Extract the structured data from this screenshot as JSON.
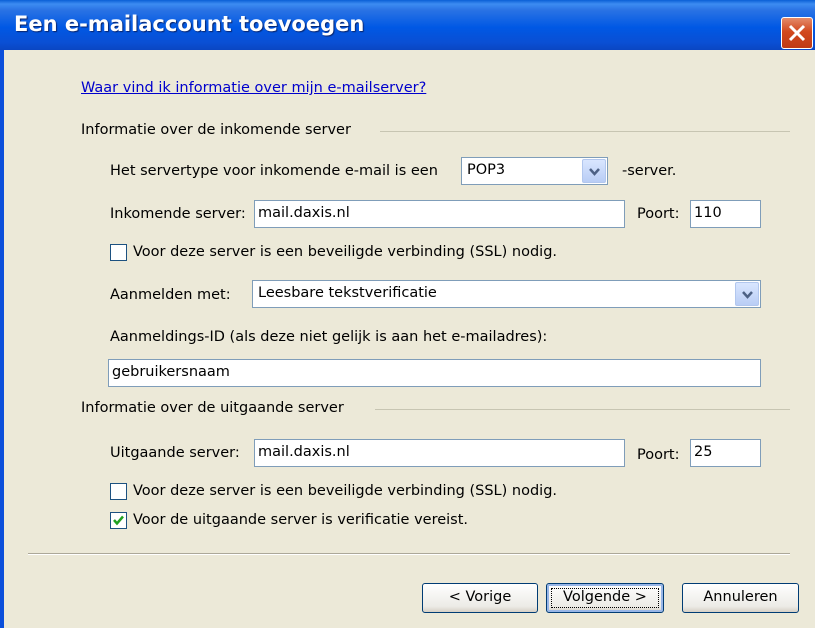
{
  "window": {
    "title": "Een e-mailaccount toevoegen"
  },
  "help_link": "Waar vind ik informatie over mijn e-mailserver?",
  "incoming": {
    "group_label": "Informatie over de inkomende server",
    "servertype_label": "Het servertype voor inkomende e-mail is een",
    "servertype_value": "POP3",
    "servertype_suffix": "-server.",
    "server_label": "Inkomende server:",
    "server_value": "mail.daxis.nl",
    "port_label": "Poort:",
    "port_value": "110",
    "ssl_label": "Voor deze server is een beveiligde verbinding (SSL) nodig.",
    "ssl_checked": false,
    "logon_label": "Aanmelden met:",
    "logon_value": "Leesbare tekstverificatie",
    "logon_id_label": "Aanmeldings-ID (als deze niet gelijk is aan het e-mailadres):",
    "logon_id_value": "gebruikersnaam"
  },
  "outgoing": {
    "group_label": "Informatie over de uitgaande server",
    "server_label": "Uitgaande server:",
    "server_value": "mail.daxis.nl",
    "port_label": "Poort:",
    "port_value": "25",
    "ssl_label": "Voor deze server is een beveiligde verbinding (SSL) nodig.",
    "ssl_checked": false,
    "auth_label": "Voor de uitgaande server is verificatie vereist.",
    "auth_checked": true
  },
  "buttons": {
    "back": "< Vorige",
    "next": "Volgende >",
    "cancel": "Annuleren"
  },
  "colors": {
    "titlebar": "#0058e4",
    "dialog_bg": "#ece9d8",
    "link": "#0000cc",
    "close_button": "#d2491f",
    "checkmark": "#21a121"
  }
}
